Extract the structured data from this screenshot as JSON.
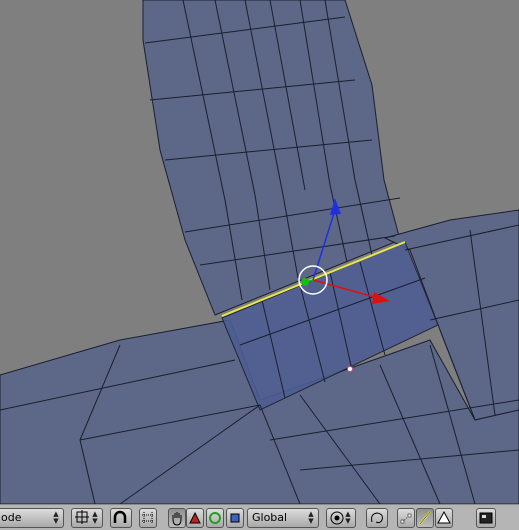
{
  "header": {
    "mode_label": "ode",
    "orientation_label": "Global"
  },
  "icons": {
    "pivot": "pivot-icon",
    "snap": "magnet-icon",
    "handle": "hand-icon",
    "translate": "translate-manipulator-icon",
    "rotate": "rotate-manipulator-icon",
    "scale": "scale-manipulator-icon",
    "proportional": "proportional-edit-icon",
    "occlude": "occlude-background-icon",
    "select_vertex": "vertex-select-icon",
    "select_edge": "edge-select-icon",
    "select_face": "face-select-icon",
    "render": "render-icon"
  },
  "colors": {
    "mesh_fill": "#5a6584",
    "mesh_wire": "#1a1f2e",
    "selected_face": "#4a5b8e",
    "selected_edge": "#e6e84a",
    "axis_x": "#e01010",
    "axis_y": "#10c010",
    "axis_z": "#2030e0",
    "background": "#7f7f7f"
  }
}
